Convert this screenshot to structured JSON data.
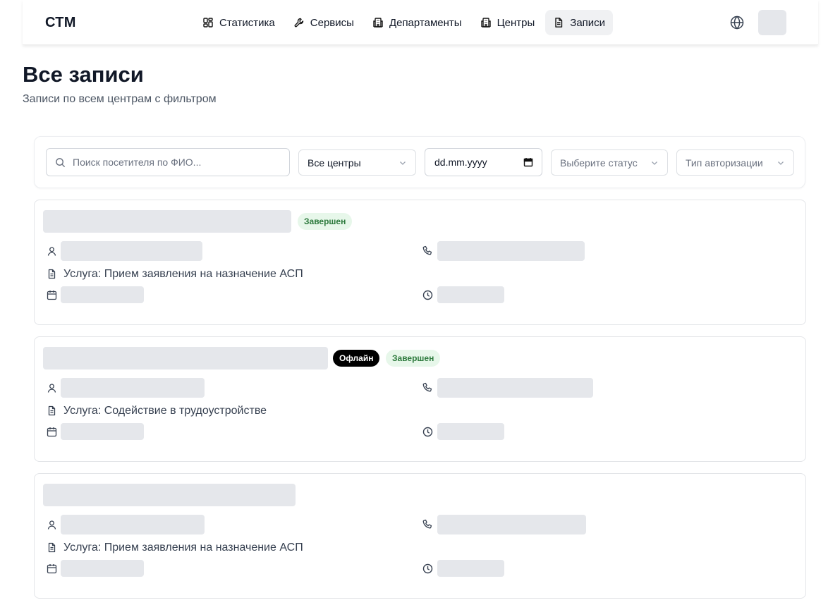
{
  "header": {
    "logo": "СТМ",
    "nav": [
      {
        "label": "Статистика",
        "icon": "grid-icon"
      },
      {
        "label": "Сервисы",
        "icon": "wrench-icon"
      },
      {
        "label": "Департаменты",
        "icon": "building-icon"
      },
      {
        "label": "Центры",
        "icon": "building-icon"
      },
      {
        "label": "Записи",
        "icon": "document-icon",
        "active": true
      }
    ],
    "language_icon": "globe-icon"
  },
  "page": {
    "title": "Все записи",
    "subtitle": "Записи по всем центрам с фильтром"
  },
  "filters": {
    "search_placeholder": "Поиск посетителя по ФИО...",
    "center_select": "Все центры",
    "date_placeholder": "dd.mm.yyyy",
    "status_placeholder": "Выберите статус",
    "auth_placeholder": "Тип авторизации"
  },
  "records": [
    {
      "badges": [
        "Завершен"
      ],
      "service": "Услуга: Прием заявления на назначение АСП"
    },
    {
      "badges": [
        "Офлайн",
        "Завершен"
      ],
      "service": "Услуга: Содействие в трудоустройстве"
    },
    {
      "badges": [],
      "service": "Услуга: Прием заявления на назначение АСП"
    }
  ],
  "colors": {
    "accent_active_bg": "#f0f1f3",
    "status_done_bg": "#e7f7ea",
    "status_done_text": "#2d7a3d",
    "offline_bg": "#000000",
    "skeleton": "#e5e7eb"
  }
}
